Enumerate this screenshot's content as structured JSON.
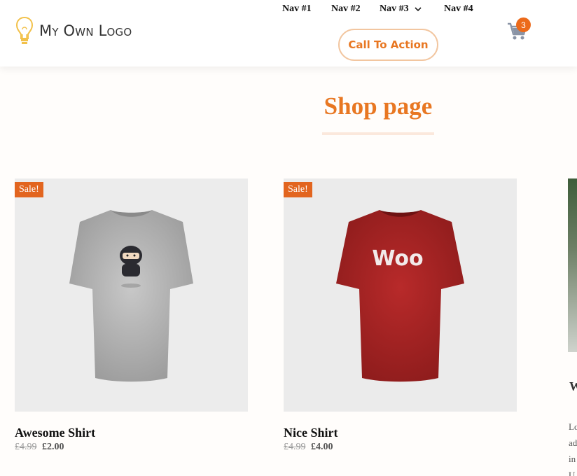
{
  "header": {
    "logo_text": "My Own Logo",
    "nav": [
      "Nav #1",
      "Nav #2",
      "Nav #3",
      "Nav #4"
    ],
    "cta_label": "Call To Action",
    "cart_count": "3"
  },
  "main": {
    "title": "Shop page",
    "products": [
      {
        "sale_badge": "Sale!",
        "name": "Awesome Shirt",
        "old_price": "£4.99",
        "price": "£2.00",
        "image": "grey-ninja-tshirt"
      },
      {
        "sale_badge": "Sale!",
        "name": "Nice Shirt",
        "old_price": "£4.99",
        "price": "£4.00",
        "image": "red-woo-tshirt"
      }
    ],
    "third_product_partial": {
      "name_fragment": "W",
      "desc_fragments": [
        "Lo",
        "ad",
        "in",
        "U"
      ]
    }
  },
  "colors": {
    "accent": "#e87722",
    "sale_badge": "#e2651f",
    "cta_border": "#f2c6a0",
    "cart_icon": "#8a94a6"
  }
}
